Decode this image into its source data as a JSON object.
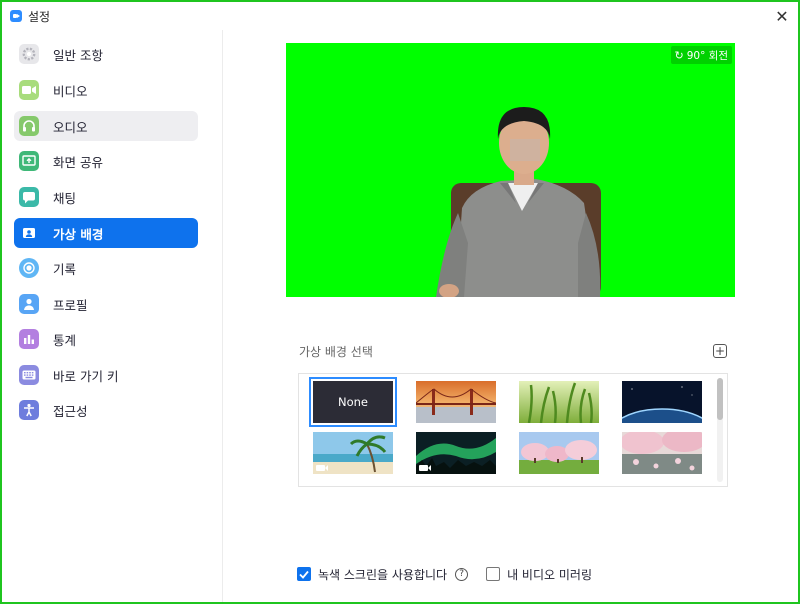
{
  "window": {
    "title": "설정",
    "close_glyph": "✕"
  },
  "sidebar": {
    "items": [
      {
        "label": "일반 조항",
        "icon": "gear-icon",
        "color": "#b9b9c0"
      },
      {
        "label": "비디오",
        "icon": "video-camera-icon",
        "color": "#9fd771"
      },
      {
        "label": "오디오",
        "icon": "headphones-icon",
        "color": "#84c86a"
      },
      {
        "label": "화면 공유",
        "icon": "screen-share-icon",
        "color": "#43b97c"
      },
      {
        "label": "채팅",
        "icon": "chat-icon",
        "color": "#3cb9a7"
      },
      {
        "label": "가상 배경",
        "icon": "virtual-background-icon",
        "color": "#ffffff"
      },
      {
        "label": "기록",
        "icon": "record-icon",
        "color": "#5fb5f4"
      },
      {
        "label": "프로필",
        "icon": "profile-icon",
        "color": "#5ba6f4"
      },
      {
        "label": "통계",
        "icon": "statistics-icon",
        "color": "#b57fe0"
      },
      {
        "label": "바로 가기 키",
        "icon": "keyboard-icon",
        "color": "#8c8ce0"
      },
      {
        "label": "접근성",
        "icon": "accessibility-icon",
        "color": "#6f7ede"
      }
    ],
    "active_index": 5,
    "hover_index": 2
  },
  "preview": {
    "rotate_label": "90° 회전",
    "background_color": "#00ff00"
  },
  "gallery": {
    "title": "가상 배경 선택",
    "add_label": "+",
    "thumbnails": [
      {
        "name": "none",
        "label": "None",
        "selected": true
      },
      {
        "name": "golden-gate-bridge",
        "video": false
      },
      {
        "name": "grass",
        "video": false
      },
      {
        "name": "earth-from-space",
        "video": false
      },
      {
        "name": "beach-palm",
        "video": true
      },
      {
        "name": "northern-lights",
        "video": true
      },
      {
        "name": "cherry-blossom-park",
        "video": false
      },
      {
        "name": "cherry-blossom-pond",
        "video": false
      }
    ]
  },
  "options": {
    "green_screen_label": "녹색 스크린을 사용합니다",
    "green_screen_checked": true,
    "help_glyph": "?",
    "mirror_label": "내 비디오 미러링",
    "mirror_checked": false
  },
  "colors": {
    "accent": "#0e72ed",
    "selection": "#2d8cff"
  }
}
